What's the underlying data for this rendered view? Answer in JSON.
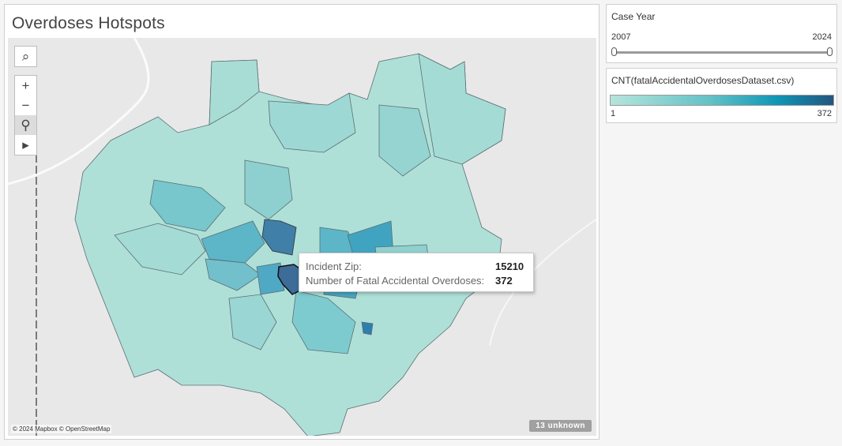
{
  "viz": {
    "title": "Overdoses Hotspots",
    "attribution": "© 2024 Mapbox © OpenStreetMap",
    "unknown_badge": "13 unknown"
  },
  "toolbar": {
    "search_icon": "search-icon",
    "zoom_in_icon": "plus-icon",
    "zoom_out_icon": "minus-icon",
    "pin_icon": "pin-icon",
    "expand_icon": "play-icon"
  },
  "tooltip": {
    "zip_label": "Incident Zip:",
    "zip_value": "15210",
    "count_label": "Number of Fatal Accidental Overdoses:",
    "count_value": "372"
  },
  "filter": {
    "title": "Case Year",
    "min": "2007",
    "max": "2024",
    "selected_range": [
      2007,
      2024
    ]
  },
  "legend": {
    "title": "CNT(fatalAccidentalOverdosesDataset.csv)",
    "min": "1",
    "max": "372",
    "colors": {
      "low": "#b6e4dc",
      "mid": "#0e96b6",
      "high": "#24557f"
    }
  },
  "colors": {
    "map_background": "#e8e8e8",
    "region_light": "#aee0d8",
    "region_mid": "#7dccd0",
    "region_dark": "#43a6c0",
    "region_darkest": "#3f6e96",
    "region_stroke": "#5d6e72"
  }
}
